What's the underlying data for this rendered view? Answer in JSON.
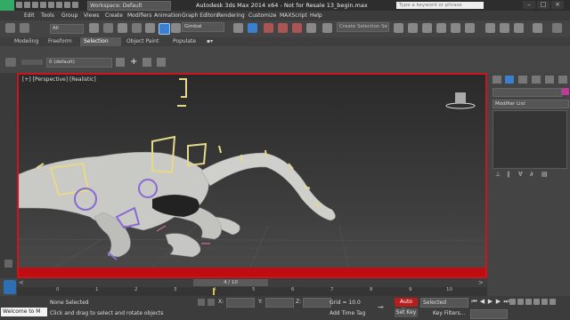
{
  "title_bar": {
    "workspace": "Workspace: Default",
    "app_title": "Autodesk 3ds Max  2014 x64 - Not for Resale   13_begin.max",
    "search_placeholder": "Type a keyword or phrase",
    "window_controls": [
      "–",
      "□",
      "×"
    ]
  },
  "menu": [
    "Edit",
    "Tools",
    "Group",
    "Views",
    "Create",
    "Modifiers",
    "Animation",
    "Graph Editors",
    "Rendering",
    "Customize",
    "MAXScript",
    "Help"
  ],
  "toolbar": {
    "selection_filter": "All",
    "reference_coord": "Gimbal",
    "named_selection": "Create Selection Se"
  },
  "ribbon_tabs": [
    "Modeling",
    "Freeform",
    "Selection",
    "Object Paint",
    "Populate"
  ],
  "ribbon_active_tab": "Selection",
  "layer": {
    "current": "0 (default)"
  },
  "viewport": {
    "label": "[+] [Perspective] [Realistic]"
  },
  "command_panel": {
    "modifier_list": "Modifier List",
    "color_swatch": "#c0389a"
  },
  "time_slider": {
    "frame_display": "4 / 10"
  },
  "timeline": {
    "ticks": [
      "0",
      "1",
      "2",
      "3",
      "4",
      "5",
      "6",
      "7",
      "8",
      "9",
      "10"
    ]
  },
  "status": {
    "maxscript_listener": "Welcome to M",
    "selection_status": "None Selected",
    "prompt": "Click and drag to select and rotate objects",
    "x_label": "X:",
    "y_label": "Y:",
    "z_label": "Z:",
    "grid": "Grid = 10.0",
    "add_time_tag": "Add Time Tag",
    "auto_key": "Auto Key",
    "set_key": "Set Key",
    "key_mode": "Selected",
    "key_filters": "Key Filters..."
  }
}
